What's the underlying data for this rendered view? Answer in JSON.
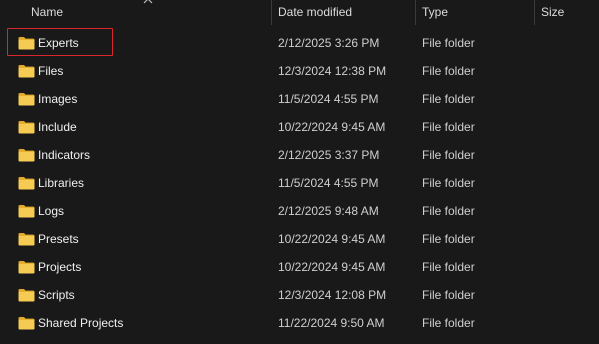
{
  "columns": {
    "name": "Name",
    "date_modified": "Date modified",
    "type": "Type",
    "size": "Size"
  },
  "accent": {
    "folder": "#f4c542",
    "highlight": "#d9262c"
  },
  "rows": [
    {
      "name": "Experts",
      "date": "2/12/2025 3:26 PM",
      "type": "File folder",
      "size": "",
      "icon": "folder-icon",
      "highlighted": true
    },
    {
      "name": "Files",
      "date": "12/3/2024 12:38 PM",
      "type": "File folder",
      "size": "",
      "icon": "folder-icon"
    },
    {
      "name": "Images",
      "date": "11/5/2024 4:55 PM",
      "type": "File folder",
      "size": "",
      "icon": "folder-icon"
    },
    {
      "name": "Include",
      "date": "10/22/2024 9:45 AM",
      "type": "File folder",
      "size": "",
      "icon": "folder-icon"
    },
    {
      "name": "Indicators",
      "date": "2/12/2025 3:37 PM",
      "type": "File folder",
      "size": "",
      "icon": "folder-icon"
    },
    {
      "name": "Libraries",
      "date": "11/5/2024 4:55 PM",
      "type": "File folder",
      "size": "",
      "icon": "folder-icon"
    },
    {
      "name": "Logs",
      "date": "2/12/2025 9:48 AM",
      "type": "File folder",
      "size": "",
      "icon": "folder-icon"
    },
    {
      "name": "Presets",
      "date": "10/22/2024 9:45 AM",
      "type": "File folder",
      "size": "",
      "icon": "folder-icon"
    },
    {
      "name": "Projects",
      "date": "10/22/2024 9:45 AM",
      "type": "File folder",
      "size": "",
      "icon": "folder-icon"
    },
    {
      "name": "Scripts",
      "date": "12/3/2024 12:08 PM",
      "type": "File folder",
      "size": "",
      "icon": "folder-icon"
    },
    {
      "name": "Shared Projects",
      "date": "11/22/2024 9:50 AM",
      "type": "File folder",
      "size": "",
      "icon": "folder-icon"
    }
  ]
}
